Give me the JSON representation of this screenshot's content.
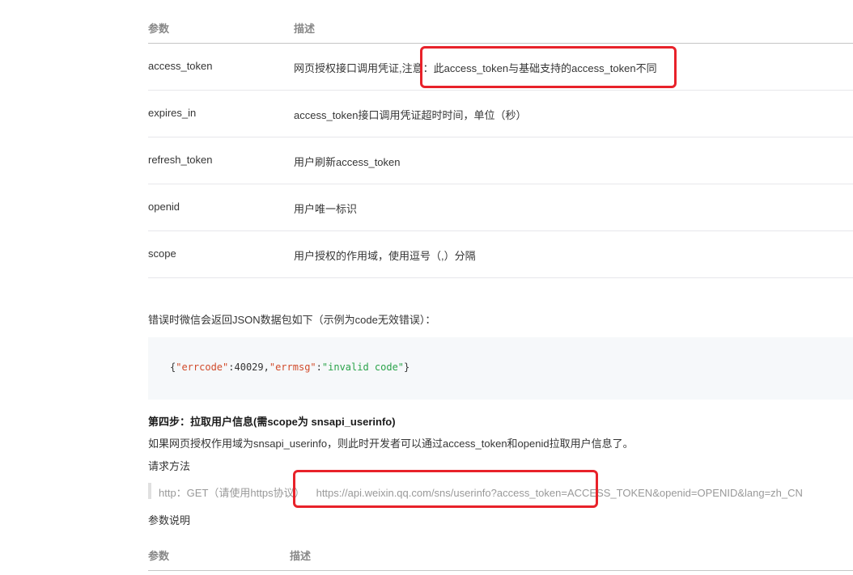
{
  "table1": {
    "headers": {
      "param": "参数",
      "desc": "描述"
    },
    "rows": [
      {
        "param": "access_token",
        "desc": "网页授权接口调用凭证,注意：此access_token与基础支持的access_token不同"
      },
      {
        "param": "expires_in",
        "desc": "access_token接口调用凭证超时时间，单位（秒）"
      },
      {
        "param": "refresh_token",
        "desc": "用户刷新access_token"
      },
      {
        "param": "openid",
        "desc": "用户唯一标识"
      },
      {
        "param": "scope",
        "desc": "用户授权的作用域，使用逗号（,）分隔"
      }
    ]
  },
  "error_intro": "错误时微信会返回JSON数据包如下（示例为code无效错误）：",
  "code": {
    "open": "{",
    "k1": "\"errcode\"",
    "colon1": ":",
    "v1": "40029",
    "comma": ",",
    "k2": "\"errmsg\"",
    "colon2": ":",
    "v2": "\"invalid code\"",
    "close": "}"
  },
  "step4": {
    "heading": "第四步：拉取用户信息(需scope为 snsapi_userinfo)",
    "intro": "如果网页授权作用域为snsapi_userinfo，则此时开发者可以通过access_token和openid拉取用户信息了。",
    "request_method_label": "请求方法",
    "request_prefix": "http：GET（请使用https协议）",
    "request_url": "https://api.weixin.qq.com/sns/userinfo?access_token=ACCESS_TOKEN&openid=OPENID&lang=zh_CN",
    "params_label": "参数说明"
  },
  "table2": {
    "headers": {
      "param": "参数",
      "desc": "描述"
    }
  },
  "highlight_color": "#e8222a"
}
